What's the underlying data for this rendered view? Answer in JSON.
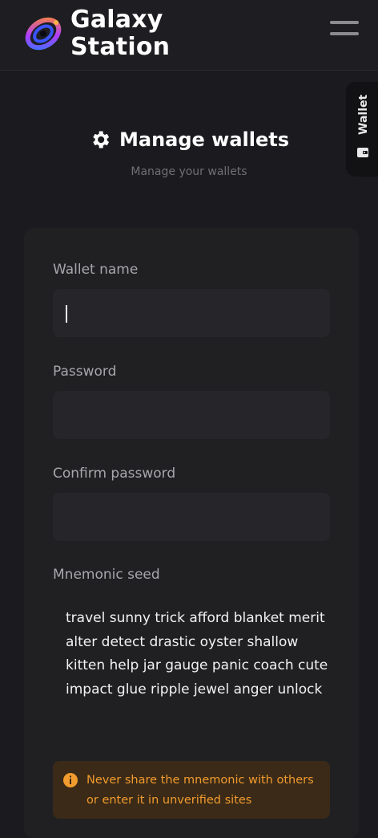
{
  "header": {
    "brand_line1": "Galaxy",
    "brand_line2": "Station",
    "logo_icon": "galaxy-swirl-logo",
    "menu_icon": "hamburger-menu-icon"
  },
  "side_tab": {
    "label": "Wallet",
    "icon": "wallet-icon"
  },
  "page": {
    "title": "Manage wallets",
    "title_icon": "gear-icon",
    "subtitle": "Manage your wallets"
  },
  "form": {
    "wallet_name_label": "Wallet name",
    "wallet_name_value": "",
    "password_label": "Password",
    "password_value": "",
    "confirm_password_label": "Confirm password",
    "confirm_password_value": "",
    "mnemonic_label": "Mnemonic seed",
    "mnemonic_value": "travel sunny trick afford blanket merit alter detect drastic oyster shallow kitten help jar gauge panic coach cute impact glue ripple jewel anger unlock"
  },
  "warning": {
    "icon": "info-icon",
    "text": "Never share the mnemonic with others or enter it in unverified sites"
  },
  "colors": {
    "background": "#1b1b1f",
    "card": "#202023",
    "input": "#26262a",
    "warning_bg": "#3a2a17",
    "warning_text": "#f29b2e"
  }
}
